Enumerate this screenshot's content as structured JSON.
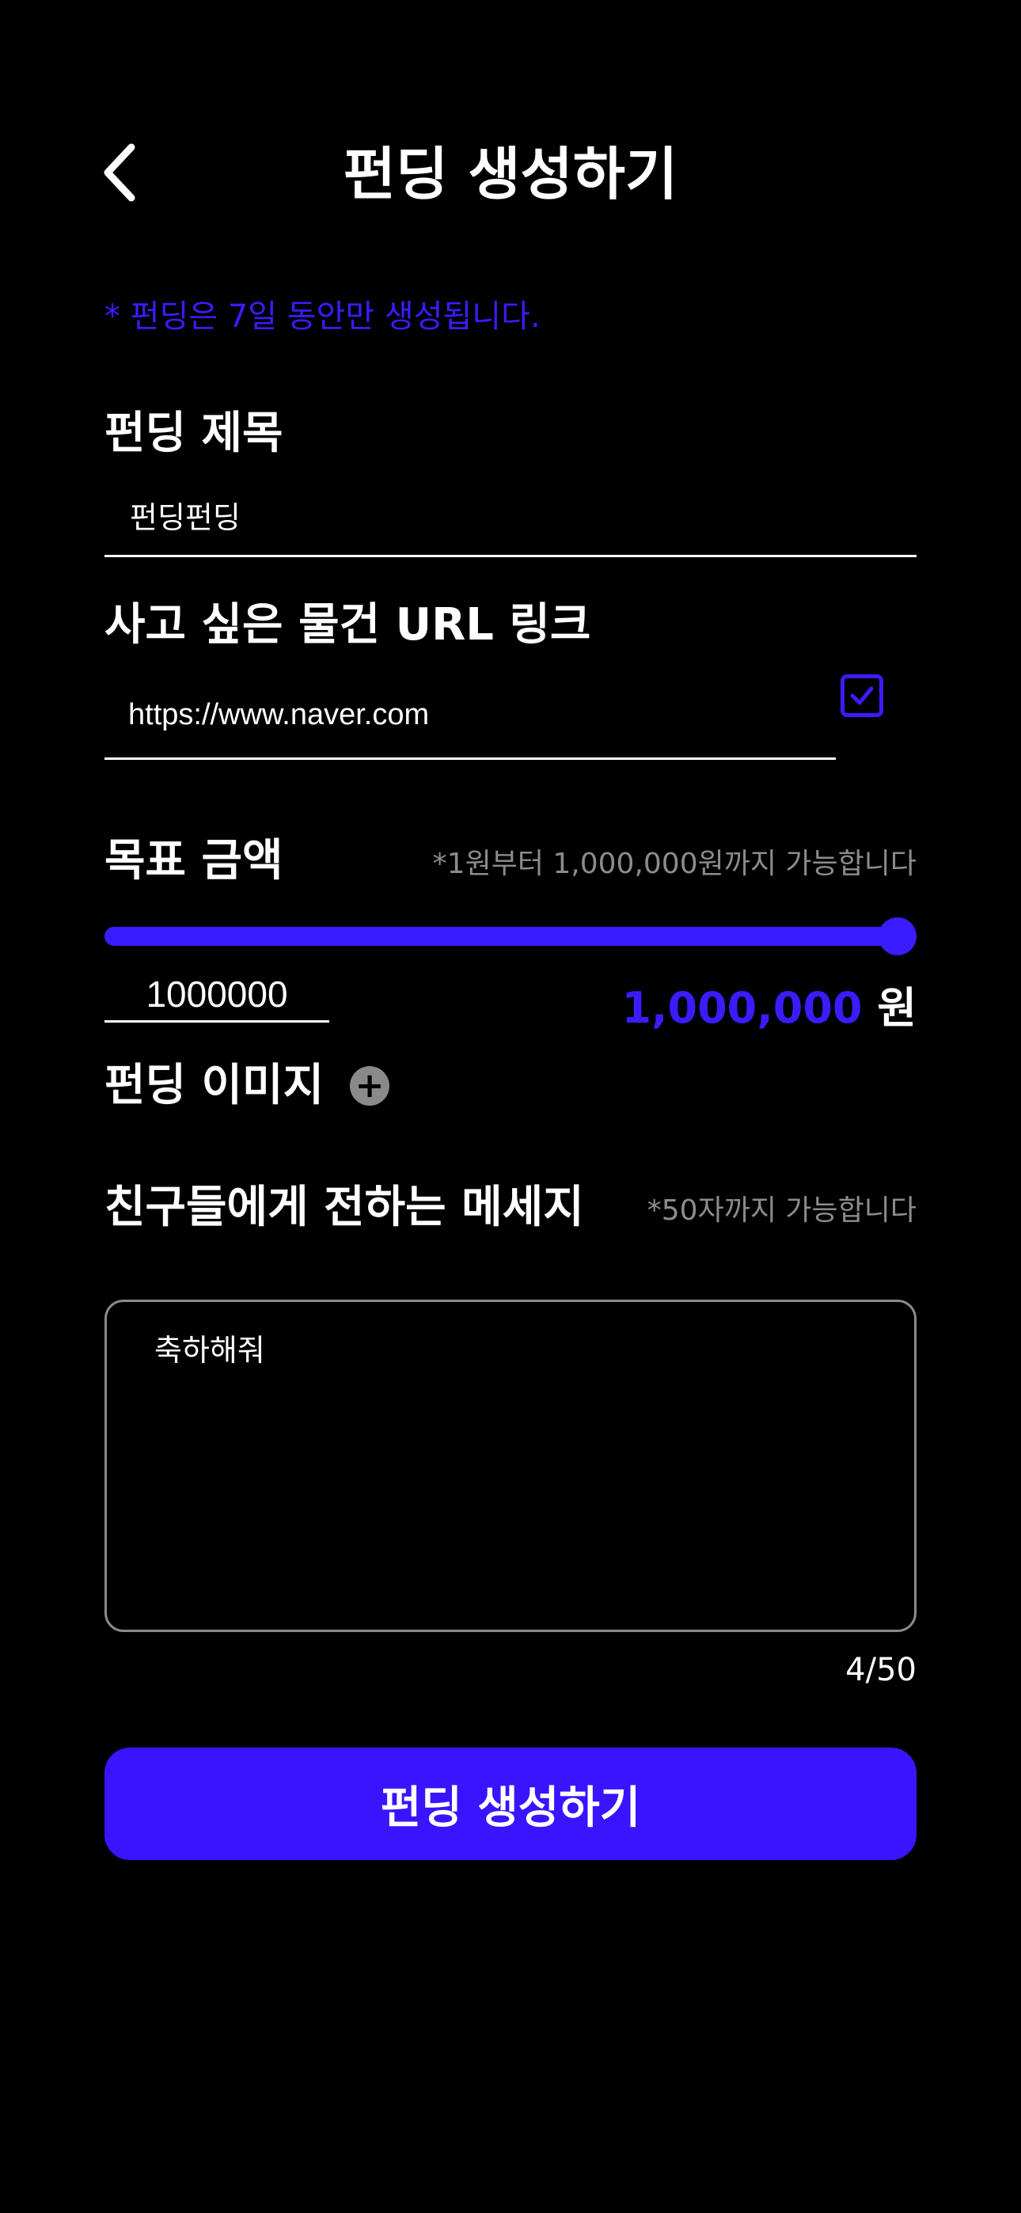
{
  "header": {
    "title": "펀딩 생성하기",
    "back_icon": "chevron-left-icon"
  },
  "notice": "* 펀딩은 7일 동안만 생성됩니다.",
  "title_field": {
    "label": "펀딩 제목",
    "value": "펀딩펀딩"
  },
  "url_field": {
    "label": "사고 싶은 물건 URL 링크",
    "value": "https://www.naver.com",
    "check_icon": "checkbox-checked-icon",
    "checked": true
  },
  "goal": {
    "label": "목표 금액",
    "hint": "*1원부터 1,000,000원까지 가능합니다",
    "slider_fraction": 1.0,
    "input_value": "1000000",
    "display_value": "1,000,000",
    "unit": "원",
    "accent_color": "#3a1cff"
  },
  "image": {
    "label": "펀딩 이미지",
    "add_icon": "plus-circle-icon"
  },
  "message": {
    "label": "친구들에게 전하는 메세지",
    "hint": "*50자까지 가능합니다",
    "value": "축하해줘",
    "counter": "4/50"
  },
  "submit": {
    "label": "펀딩 생성하기",
    "color": "#3a14ff"
  }
}
